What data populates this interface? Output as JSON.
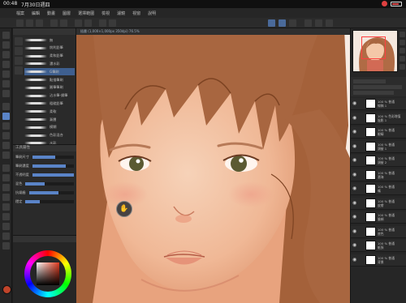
{
  "status_bar": {
    "time": "00:48",
    "date": "7月30日週四",
    "battery_icon": "battery-icon",
    "record_icon": "record-icon"
  },
  "menu": {
    "items": [
      "檔案",
      "編輯",
      "動畫",
      "圖層",
      "選擇範圍",
      "檢視",
      "濾鏡",
      "視窗",
      "說明"
    ]
  },
  "canvas": {
    "tab_label": "插畫 (1,000×1,000px 350dpi) 76.5%"
  },
  "colors": {
    "skin": "#e9a882",
    "hair": "#a4613a",
    "accent_blue": "#5a84c8",
    "main_color": "#c0442a"
  },
  "brushes": [
    {
      "label": "無",
      "selected": false
    },
    {
      "label": "銳利鉛筆",
      "selected": false
    },
    {
      "label": "柔和鉛筆",
      "selected": false
    },
    {
      "label": "濃水彩",
      "selected": false
    },
    {
      "label": "G筆刷",
      "selected": true
    },
    {
      "label": "點描筆刷",
      "selected": false
    },
    {
      "label": "圓筆筆刷",
      "selected": false
    },
    {
      "label": "沾水筆-鋼筆",
      "selected": false
    },
    {
      "label": "粗糙鉛筆",
      "selected": false
    },
    {
      "label": "柔軟",
      "selected": false
    },
    {
      "label": "漸層",
      "selected": false
    },
    {
      "label": "模糊",
      "selected": false
    },
    {
      "label": "色彩混合",
      "selected": false
    },
    {
      "label": "水彩",
      "selected": false
    }
  ],
  "tool_property": {
    "title": "工具屬性",
    "rows": [
      "筆刷尺寸",
      "筆刷濃度",
      "不透明度",
      "混色",
      "抗鋸齒",
      "穩定"
    ]
  },
  "layers": [
    {
      "name": "線稿 1",
      "sub": "100 % 普通"
    },
    {
      "name": "陰影 1",
      "sub": "100 % 色彩增值"
    },
    {
      "name": "眼睛",
      "sub": "100 % 普通"
    },
    {
      "name": "頭髮 1",
      "sub": "100 % 普通"
    },
    {
      "name": "頭髮 2",
      "sub": "100 % 普通"
    },
    {
      "name": "瀏海",
      "sub": "100 % 普通"
    },
    {
      "name": "嘴",
      "sub": "100 % 普通"
    },
    {
      "name": "皮膚",
      "sub": "100 % 普通"
    },
    {
      "name": "臉頰",
      "sub": "100 % 普通"
    },
    {
      "name": "底色",
      "sub": "100 % 普通"
    },
    {
      "name": "紙張",
      "sub": "100 % 普通"
    },
    {
      "name": "背景",
      "sub": "100 % 普通"
    }
  ]
}
